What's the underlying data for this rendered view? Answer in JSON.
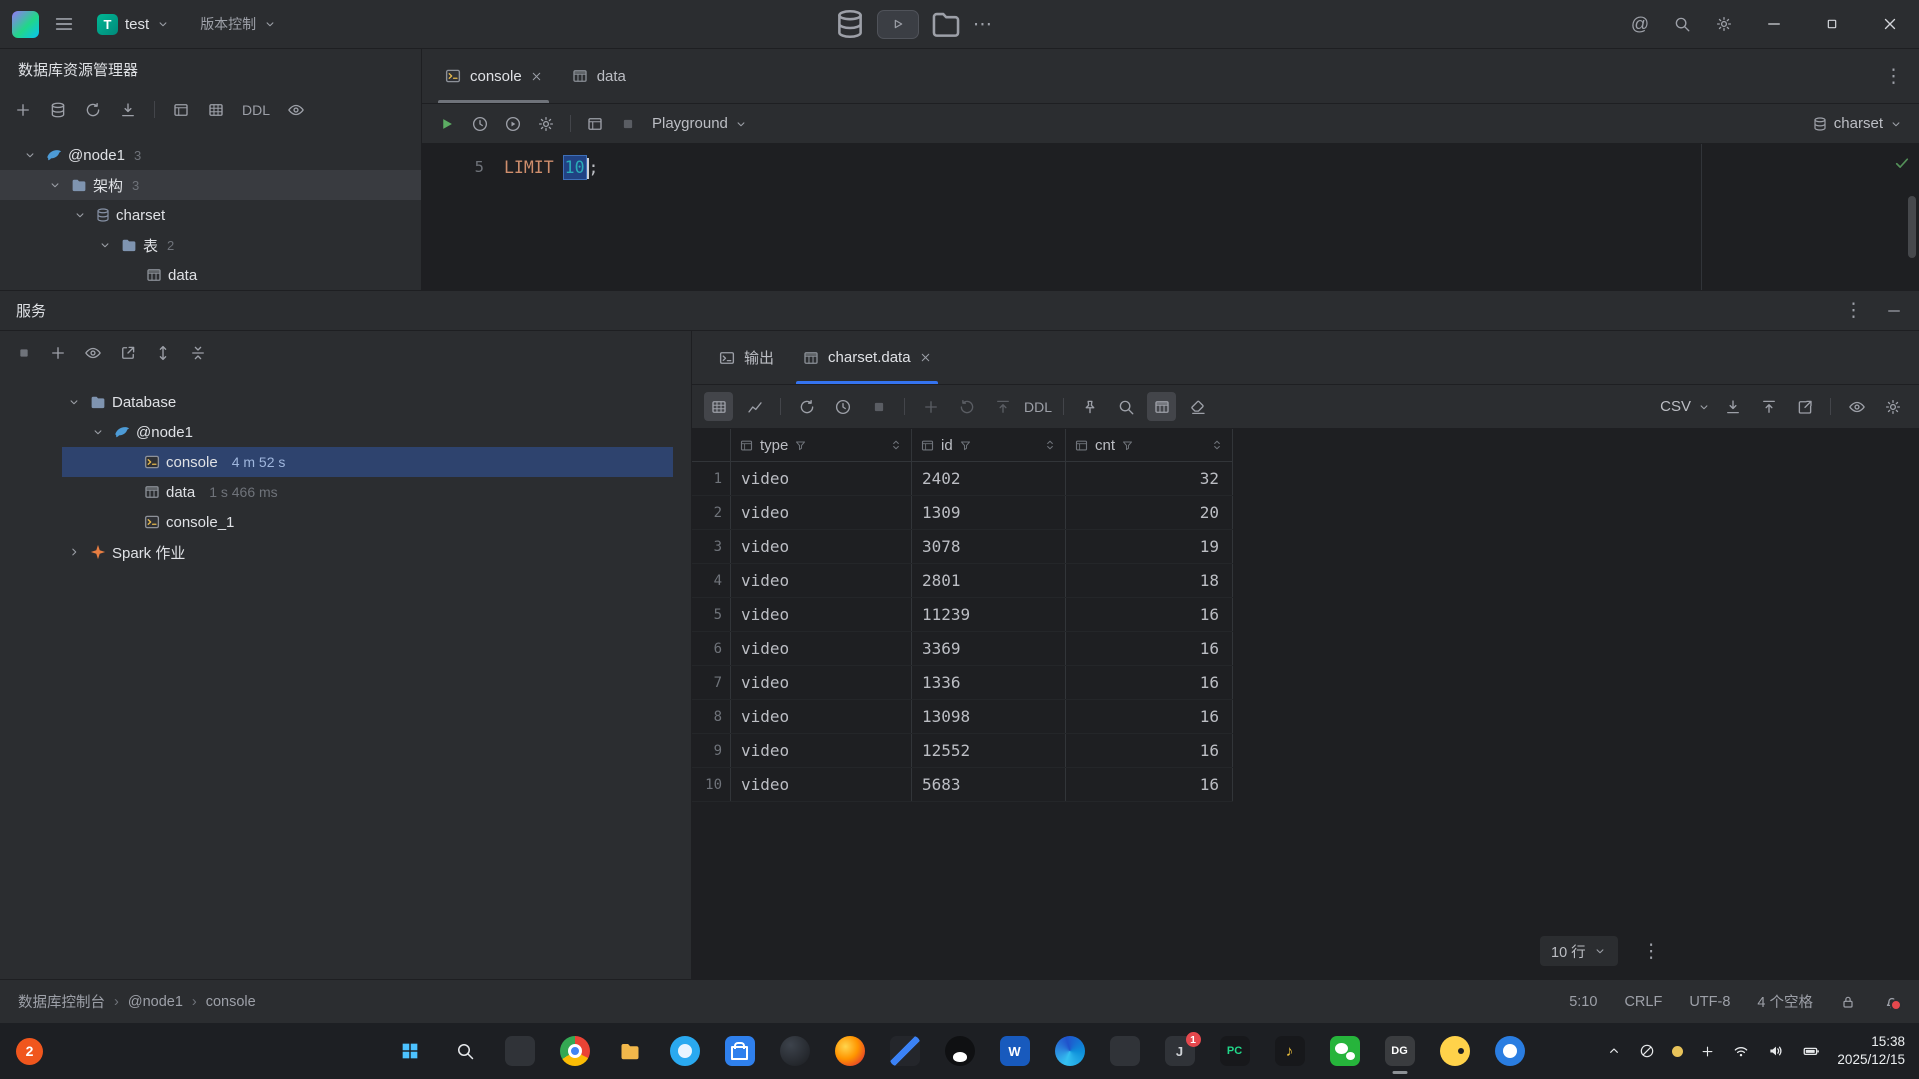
{
  "titlebar": {
    "project": "test",
    "vcs": "版本控制"
  },
  "db_explorer": {
    "title": "数据库资源管理器",
    "ddl": "DDL",
    "node1": "@node1",
    "node1_badge": "3",
    "schema_folder": "架构",
    "schema_badge": "3",
    "charset": "charset",
    "tables_folder": "表",
    "tables_badge": "2",
    "data_table": "data"
  },
  "editor": {
    "tab_console": "console",
    "tab_data": "data",
    "profile": "Playground",
    "session": "charset",
    "line_no": "5",
    "kw": "LIMIT",
    "num": "10",
    "semi": ";"
  },
  "services": {
    "title": "服务",
    "database": "Database",
    "node1": "@node1",
    "console": "console",
    "console_time": "4 m 52 s",
    "data": "data",
    "data_time": "1 s 466 ms",
    "console1": "console_1",
    "spark": "Spark 作业"
  },
  "output": {
    "tab_output": "输出",
    "tab_grid": "charset.data",
    "ddl": "DDL",
    "csv": "CSV",
    "col_type": "type",
    "col_id": "id",
    "col_cnt": "cnt",
    "rows": [
      {
        "n": "1",
        "type": "video",
        "id": "2402",
        "cnt": "32"
      },
      {
        "n": "2",
        "type": "video",
        "id": "1309",
        "cnt": "20"
      },
      {
        "n": "3",
        "type": "video",
        "id": "3078",
        "cnt": "19"
      },
      {
        "n": "4",
        "type": "video",
        "id": "2801",
        "cnt": "18"
      },
      {
        "n": "5",
        "type": "video",
        "id": "11239",
        "cnt": "16"
      },
      {
        "n": "6",
        "type": "video",
        "id": "3369",
        "cnt": "16"
      },
      {
        "n": "7",
        "type": "video",
        "id": "1336",
        "cnt": "16"
      },
      {
        "n": "8",
        "type": "video",
        "id": "13098",
        "cnt": "16"
      },
      {
        "n": "9",
        "type": "video",
        "id": "12552",
        "cnt": "16"
      },
      {
        "n": "10",
        "type": "video",
        "id": "5683",
        "cnt": "16"
      }
    ],
    "page_size": "10 行"
  },
  "statusbar": {
    "crumb1": "数据库控制台",
    "crumb2": "@node1",
    "crumb3": "console",
    "caret": "5:10",
    "eol": "CRLF",
    "enc": "UTF-8",
    "indent": "4 个空格"
  },
  "taskbar": {
    "widget_badge": "2",
    "app_badge": "1",
    "time": "15:38",
    "date": "2025/12/15"
  }
}
